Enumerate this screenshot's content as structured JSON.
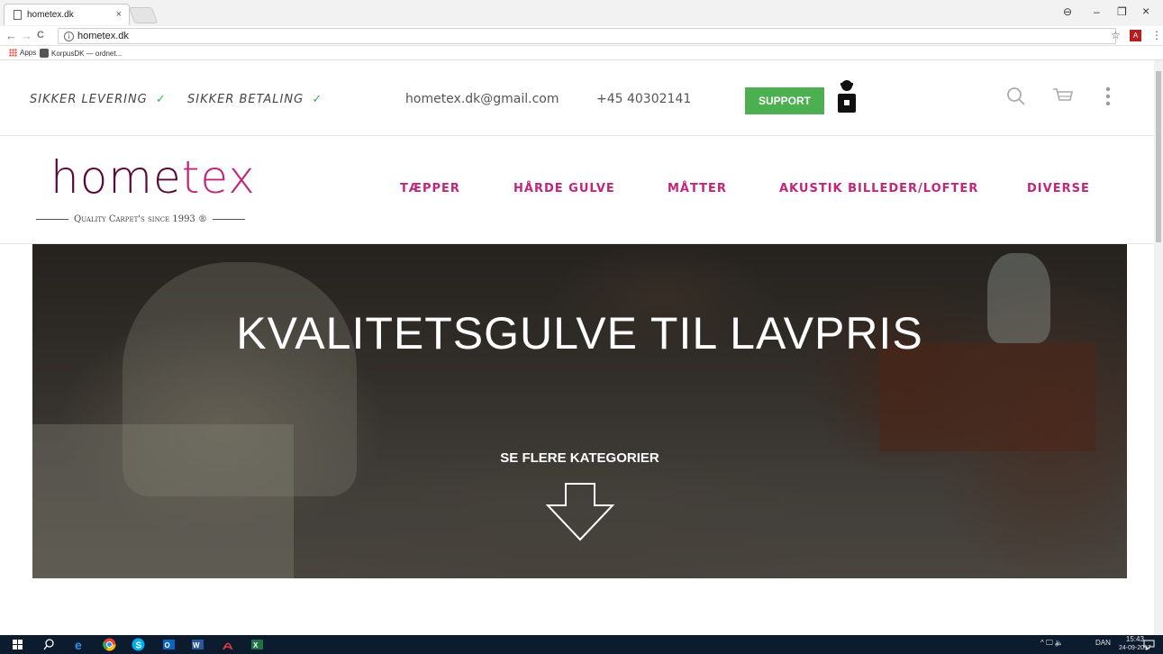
{
  "browser": {
    "tab_title": "hometex.dk",
    "tab_close": "×",
    "url": "hometex.dk",
    "back": "←",
    "forward": "→",
    "reload": "C",
    "info": "i",
    "star": "☆",
    "pdf": "A",
    "menu": "⋮",
    "bookmarks": [
      {
        "label": "Apps"
      },
      {
        "label": "KorpusDK — ordnet..."
      }
    ],
    "window_controls": {
      "account": "⊖",
      "minimize": "–",
      "restore": "❐",
      "close": "×"
    }
  },
  "topbar": {
    "trust": [
      {
        "label": "SIKKER LEVERING",
        "check": "✓"
      },
      {
        "label": "SIKKER BETALING",
        "check": "✓"
      }
    ],
    "email": "hometex.dk@gmail.com",
    "phone": "+45 40302141",
    "support_label": "SUPPORT",
    "colors": {
      "support": "#4caf50",
      "check": "#39b54a"
    }
  },
  "header": {
    "logo_part1": "home",
    "logo_part2": "tex",
    "logo_tagline": "Quality Carpet's since 1993 ®",
    "nav": [
      "TÆPPER",
      "HÅRDE GULVE",
      "MÅTTER",
      "AKUSTIK BILLEDER/LOFTER",
      "DIVERSE"
    ],
    "colors": {
      "logo_dark": "#5a0a3a",
      "accent": "#c0267a"
    }
  },
  "hero": {
    "title": "KVALITETSGULVE TIL LAVPRIS",
    "cta": "SE FLERE KATEGORIER"
  },
  "taskbar": {
    "tray_language": "DAN",
    "time": "15:43",
    "date": "24-09-2017",
    "tray_symbols": "^ 🖵 🔈"
  }
}
